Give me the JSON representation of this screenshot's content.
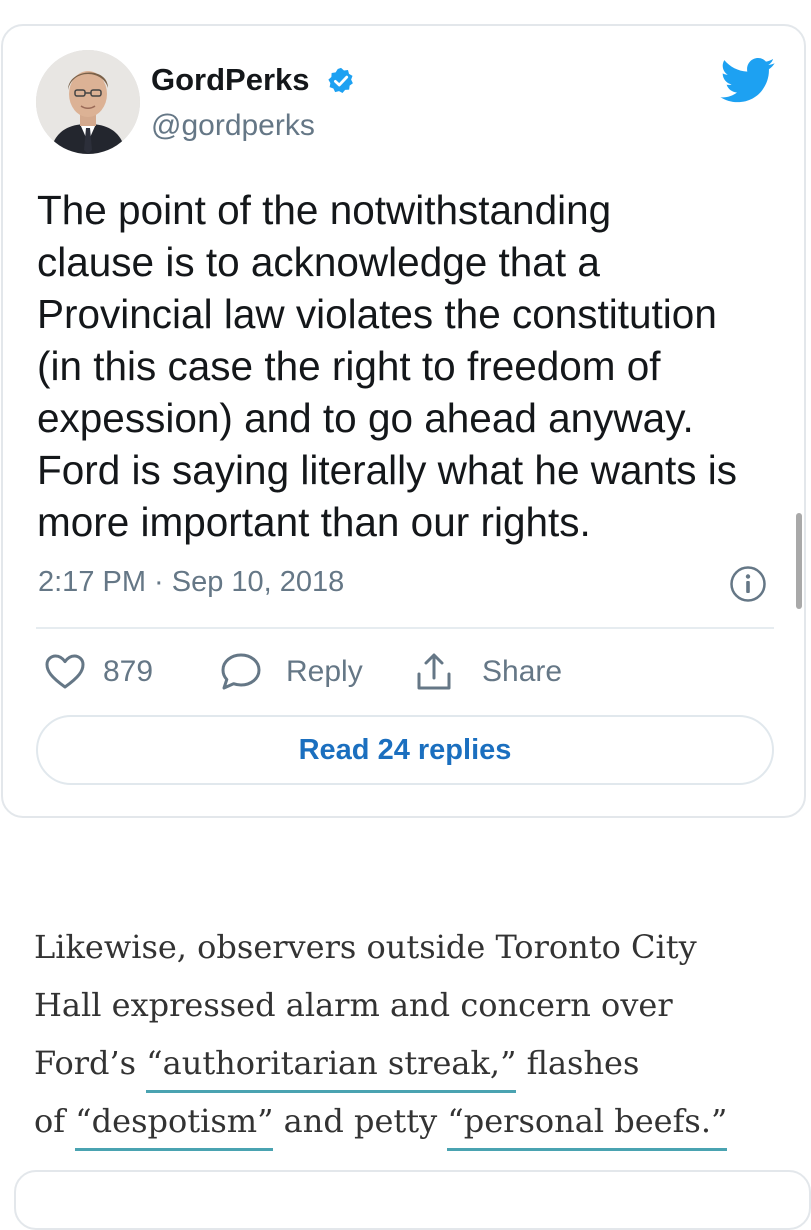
{
  "tweet": {
    "display_name": "GordPerks",
    "handle": "@gordperks",
    "text_lines": [
      "The point of the notwithstanding",
      "clause is to acknowledge that a",
      "Provincial law violates the constitution",
      "(in this case the right to freedom of",
      "expession) and to go ahead anyway.",
      "Ford is saying literally what he wants is",
      "more important than our rights."
    ],
    "timestamp": "2:17 PM · Sep 10, 2018",
    "like_count": "879",
    "reply_label": "Reply",
    "share_label": "Share",
    "read_replies_label": "Read 24 replies",
    "accent_color": "#1da1f2",
    "icons": [
      "avatar",
      "verified-icon",
      "twitter-bird-icon",
      "info-icon",
      "heart-icon",
      "reply-bubble-icon",
      "share-icon"
    ]
  },
  "article": {
    "line1": "Likewise, observers outside Toronto City",
    "line2": "Hall expressed alarm and concern over",
    "line3_prefix": "Ford’s ",
    "link1": "“authoritarian streak,”",
    "line3_suffix": " flashes",
    "line4_prefix": "of ",
    "link2": "“despotism”",
    "line4_middle": " and petty ",
    "link3": "“personal beefs.”",
    "link_underline_color": "#4aa3b1"
  }
}
